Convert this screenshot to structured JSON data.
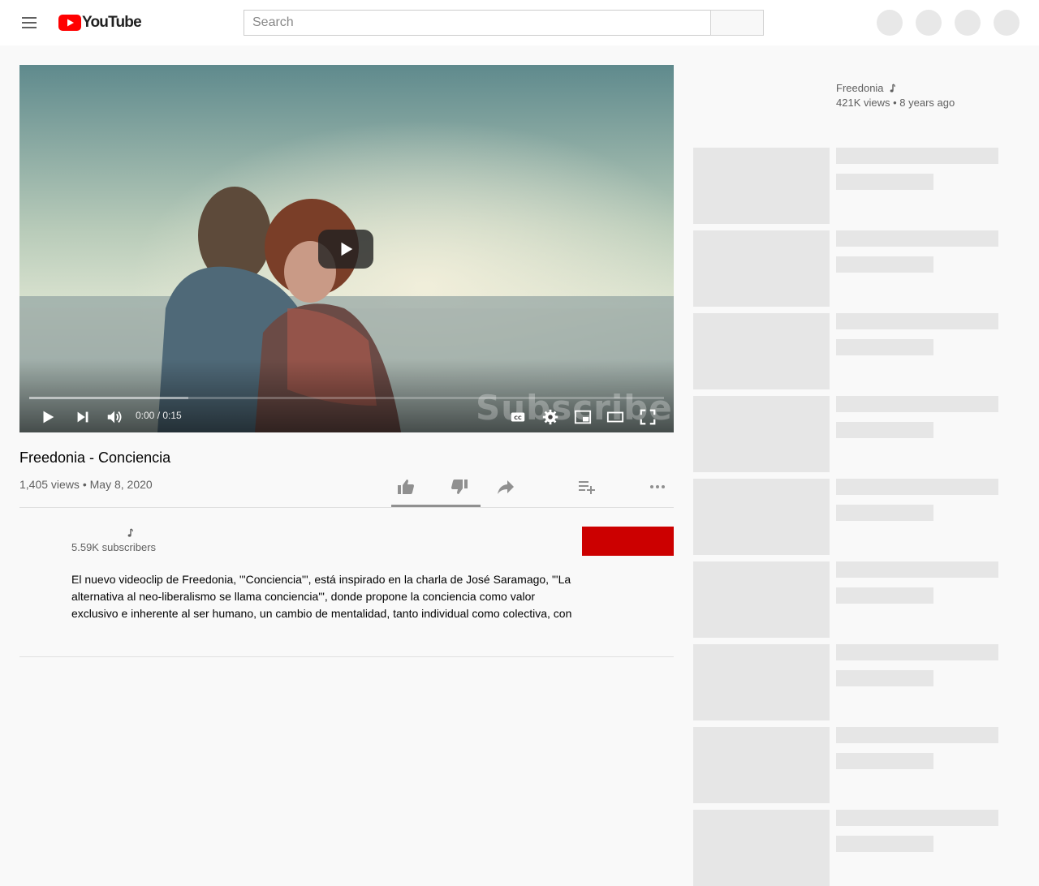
{
  "masthead": {
    "logo_text": "YouTube",
    "search_placeholder": "Search"
  },
  "player": {
    "time_display": "0:00 / 0:15",
    "watermark": "Subscribe Now",
    "progress_loaded": 0.25
  },
  "video": {
    "title": "Freedonia - Conciencia",
    "views": "1,405 views",
    "date": "May 8, 2020",
    "meta_separator": "•"
  },
  "owner": {
    "subscribers": "5.59K subscribers"
  },
  "description": {
    "text": "El nuevo videoclip de Freedonia, \"'Conciencia'\", está inspirado en la charla de José Saramago, \"'La alternativa al neo-liberalismo se llama conciencia'\", donde propone la conciencia como valor exclusivo e inherente al ser humano, un cambio de mentalidad, tanto individual como colectiva, con"
  },
  "sidebar": {
    "featured": {
      "channel": "Freedonia",
      "views": "421K views",
      "separator": "•",
      "age": "8 years ago"
    },
    "placeholder_count": 9
  },
  "colors": {
    "subscribe": "#cc0000",
    "placeholder": "#e6e6e6",
    "background": "#f9f9f9"
  },
  "icons": [
    "menu-icon",
    "youtube-logo-icon",
    "play-icon",
    "next-icon",
    "volume-icon",
    "captions-icon",
    "settings-icon",
    "miniplayer-icon",
    "theater-icon",
    "fullscreen-icon",
    "like-icon",
    "dislike-icon",
    "share-icon",
    "save-playlist-icon",
    "more-icon",
    "music-note-icon"
  ]
}
